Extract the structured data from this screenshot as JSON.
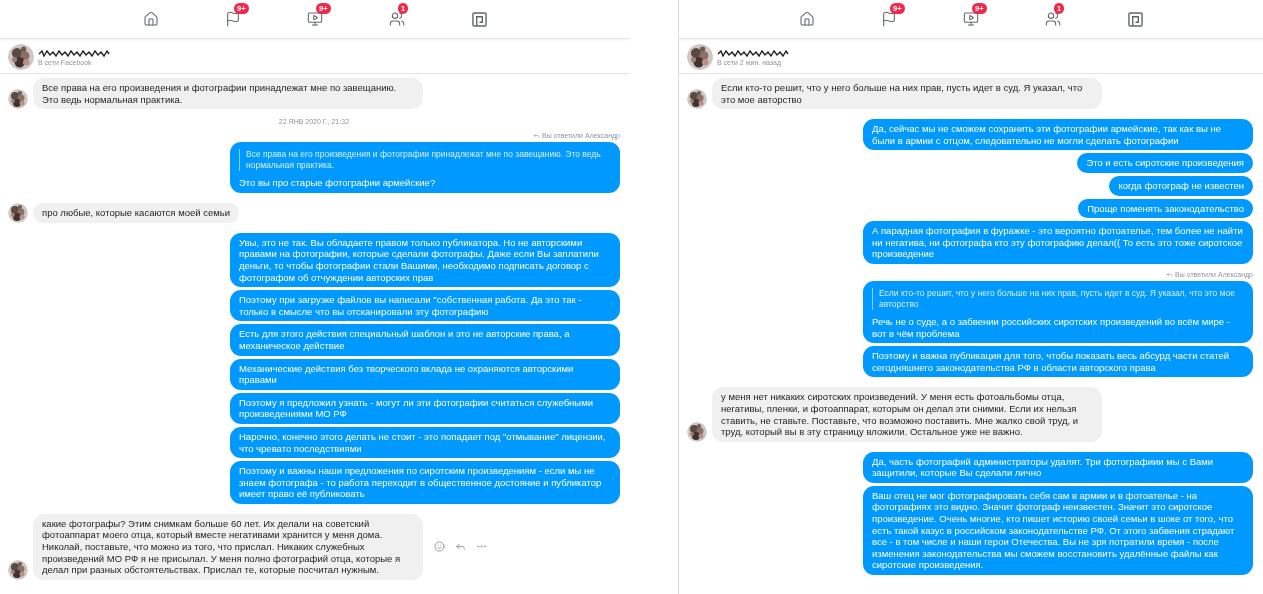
{
  "panels": [
    {
      "nav": [
        {
          "kind": "home"
        },
        {
          "kind": "flag",
          "badge": "9+"
        },
        {
          "kind": "video",
          "badge": "9+"
        },
        {
          "kind": "group",
          "badge": "1"
        },
        {
          "kind": "gaming"
        }
      ],
      "header": {
        "status": "В сети Facebook"
      },
      "messages": [
        {
          "kind": "incoming",
          "text": "Все права на его произведения и фотографии принадлежат мне по завещанию. Это ведь нормальная практика.",
          "hovered": false
        },
        {
          "kind": "timestamp",
          "text": "22 ЯНВ 2020 Г., 21:32"
        },
        {
          "kind": "reply_note",
          "text": "Вы ответили Александр"
        },
        {
          "kind": "outgoing",
          "quote": "Все права на его произведения и фотографии принадлежат мне по завещанию. Это ведь нормальная практика.",
          "text": "Это вы про старые фотографии армейские?"
        },
        {
          "kind": "incoming",
          "text": "про любые, которые касаются моей семьи",
          "hovered": false
        },
        {
          "kind": "outgoing",
          "text": "Увы, это не так. Вы обладаете правом только публикатора. Но не авторскими правами на фотографии, которые сделали фотографы. Даже если Вы заплатили деньги, то чтобы фотографии стали Вашими, необходимо подписать договор с фотографом об отчуждении авторских прав"
        },
        {
          "kind": "outgoing",
          "text": "Поэтому при загрузке файлов вы написали \"собственная работа. Да это так - только в смысле что вы отсканировали эту фотографию"
        },
        {
          "kind": "outgoing",
          "text": "Есть для этого действия специальный шаблон и это не авторские права, а механическое действие"
        },
        {
          "kind": "outgoing",
          "text": "Механические действия без творческого вклада не охраняются авторскими правами"
        },
        {
          "kind": "outgoing",
          "text": "Поэтому я предложил узнать - могут ли эти фотографии считаться служебными произведениями МО РФ"
        },
        {
          "kind": "outgoing",
          "text": "Нарочно, конечно этого делать не стоит - это попадает под \"отмывание\" лицензии, что чревато последствиями"
        },
        {
          "kind": "outgoing",
          "text": "Поэтому и важны наши предложения по сиротским произведениям - если мы не знаем фотографа - то работа переходит в общественное достояние и публикатор имеет право её публиковать"
        },
        {
          "kind": "incoming",
          "text": "какие фотографы? Этим снимкам больше 60 лет. Их делали на советский фотоаппарат моего отца, который вместе негативами хранится у меня дома. Николай, поставьте, что можно из того, что прислал. Никаких служебных произведений МО РФ я не присылал. У меня полно фотографий отца, которые я делал при разных обстоятельствах. Прислал те, которые посчитал нужным.",
          "hovered": true
        }
      ]
    },
    {
      "nav": [
        {
          "kind": "home"
        },
        {
          "kind": "flag",
          "badge": "9+"
        },
        {
          "kind": "video",
          "badge": "9+"
        },
        {
          "kind": "group",
          "badge": "1"
        },
        {
          "kind": "gaming"
        }
      ],
      "header": {
        "status": "В сети 2 мин. назад"
      },
      "messages": [
        {
          "kind": "incoming",
          "text": "Если кто-то решит, что у него больше на них прав, пусть идет в суд. Я указал, что это мое авторство",
          "hovered": false
        },
        {
          "kind": "outgoing",
          "text": "Да, сейчас мы не сможем сохранить эти фотографии армейские, так как вы не были в армии с отцом, следовательно не могли сделать фотографии"
        },
        {
          "kind": "outgoing",
          "text": "Это и есть сиротские произведения"
        },
        {
          "kind": "outgoing",
          "text": "когда фотограф не известен"
        },
        {
          "kind": "outgoing",
          "text": "Проще поменять законодательство"
        },
        {
          "kind": "outgoing",
          "text": "А парадная фотография в фуражке - это вероятно фотоателье, тем более не найти ни негатива, ни фотографа кто эту фотографию делал(( То есть это тоже сиротское произведение"
        },
        {
          "kind": "reply_note",
          "text": "Вы ответили Александр"
        },
        {
          "kind": "outgoing",
          "quote": "Если кто-то решит, что у него больше на них прав, пусть идет в суд. Я указал, что это мое авторство",
          "text": "Речь не о суде, а о забвении российских сиротских произведений во всём мире - вот в чём проблема"
        },
        {
          "kind": "outgoing",
          "text": "Поэтому и важна публикация для того, чтобы показать весь абсурд части статей сегодняшнего законодательства РФ в области авторского права"
        },
        {
          "kind": "incoming",
          "text": "у меня нет никаких сиротских произведений. У меня есть фотоальбомы отца, негативы, пленки, и фотоаппарат, которым он делал эти снимки. Если их нельзя ставить, не ставьте. Поставьте, что возможно поставить. Мне жалко свой труд, и труд, который вы в эту страницу вложили. Остальное уже не важно.",
          "hovered": false
        },
        {
          "kind": "outgoing",
          "text": "Да, часть фотографий администраторы удалят. Три фотографиии мы с Вами защитили, которые Вы сделали лично"
        },
        {
          "kind": "outgoing",
          "text": "Ваш отец не мог фотографировать себя сам в армии и в фотоателье - на фотографиях это видно. Значит фотограф неизвестен. Значит это сиротское произведение. Очень многие, кто пишет историю своей семьи в шоке от того, что есть такой казус в российском законодательстве РФ. От этого забвения страдают все - в том числе и наши герои Отечества. Вы не зря потратили время - после изменения законодательства мы сможем восстановить удалённые файлы как сиротские произведения."
        }
      ]
    }
  ]
}
